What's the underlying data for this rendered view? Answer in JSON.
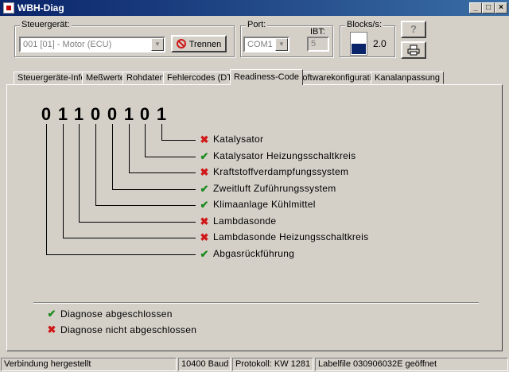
{
  "window": {
    "title": "WBH-Diag",
    "minimize": "_",
    "maximize": "□",
    "close": "×"
  },
  "controller": {
    "label": "Steuergerät:",
    "value": "001 [01] - Motor (ECU)",
    "disconnect_label": "Trennen"
  },
  "port": {
    "label": "Port:",
    "value": "COM1",
    "ibt_label": "IBT:",
    "ibt_value": "5"
  },
  "blocks": {
    "label": "Blocks/s:",
    "value": "2.0",
    "level": 0.45
  },
  "tabs": [
    {
      "label": "Steuergeräte-Infos"
    },
    {
      "label": "Meßwerte"
    },
    {
      "label": "Rohdaten"
    },
    {
      "label": "Fehlercodes (DTC)"
    },
    {
      "label": "Readiness-Code"
    },
    {
      "label": "Softwarekonfiguration"
    },
    {
      "label": "Kanalanpassung"
    }
  ],
  "active_tab": "Readiness-Code",
  "readiness": {
    "digits": [
      "0",
      "1",
      "1",
      "0",
      "0",
      "1",
      "0",
      "1"
    ],
    "items": [
      {
        "label": "Katalysator",
        "status": "fail"
      },
      {
        "label": "Katalysator Heizungsschaltkreis",
        "status": "ok"
      },
      {
        "label": "Kraftstoffverdampfungssystem",
        "status": "fail"
      },
      {
        "label": "Zweitluft Zuführungssystem",
        "status": "ok"
      },
      {
        "label": "Klimaanlage Kühlmittel",
        "status": "ok"
      },
      {
        "label": "Lambdasonde",
        "status": "fail"
      },
      {
        "label": "Lambdasonde Heizungsschaltkreis",
        "status": "fail"
      },
      {
        "label": "Abgasrückführung",
        "status": "ok"
      }
    ]
  },
  "legend": {
    "done": "Diagnose abgeschlossen",
    "not_done": "Diagnose nicht abgeschlossen"
  },
  "icons": {
    "ok": "checkmark-icon",
    "fail": "cross-icon",
    "check": "✔",
    "cross": "✖"
  },
  "colors": {
    "ok": "#1d8a1d",
    "fail": "#d01818",
    "titlebar": "#0a246a"
  },
  "statusbar": {
    "connection": "Verbindung hergestellt",
    "baud": "10400 Baud",
    "protocol": "Protokoll: KW 1281",
    "labelfile": "Labelfile 030906032E geöffnet"
  }
}
